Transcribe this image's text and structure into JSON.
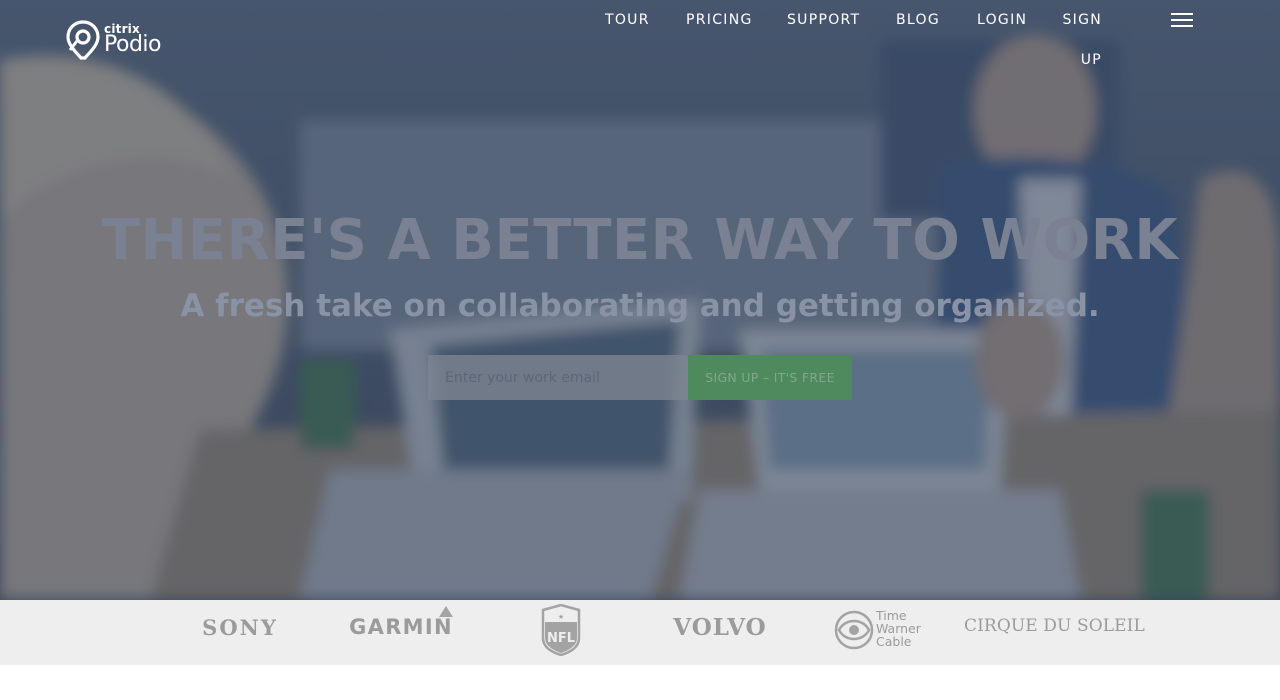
{
  "brand": {
    "name": "Podio",
    "parent": "citrix",
    "icon": "podio-location-pin-icon"
  },
  "nav": {
    "items": [
      {
        "label": "TOUR"
      },
      {
        "label": "PRICING"
      },
      {
        "label": "SUPPORT"
      },
      {
        "label": "BLOG"
      },
      {
        "label": "LOGIN"
      },
      {
        "label": "SIGN UP"
      }
    ],
    "menu_icon": "hamburger-menu-icon"
  },
  "hero": {
    "headline": "THERE'S A BETTER WAY TO WORK",
    "subheadline": "A fresh take on collaborating and getting organized.",
    "email_placeholder": "Enter your work email",
    "email_value": "",
    "signup_label": "SIGN UP – IT'S FREE"
  },
  "customers": {
    "logos": [
      {
        "name": "SONY"
      },
      {
        "name": "GARMIN"
      },
      {
        "name": "NFL"
      },
      {
        "name": "VOLVO"
      },
      {
        "name": "Time Warner Cable"
      },
      {
        "name": "CIRQUE DU SOLEIL"
      }
    ]
  },
  "colors": {
    "overlay": "#34425a",
    "signup_green": "#4f8a5e",
    "logo_strip": "#eeeeee",
    "logo_gray": "#9b9b9b"
  }
}
